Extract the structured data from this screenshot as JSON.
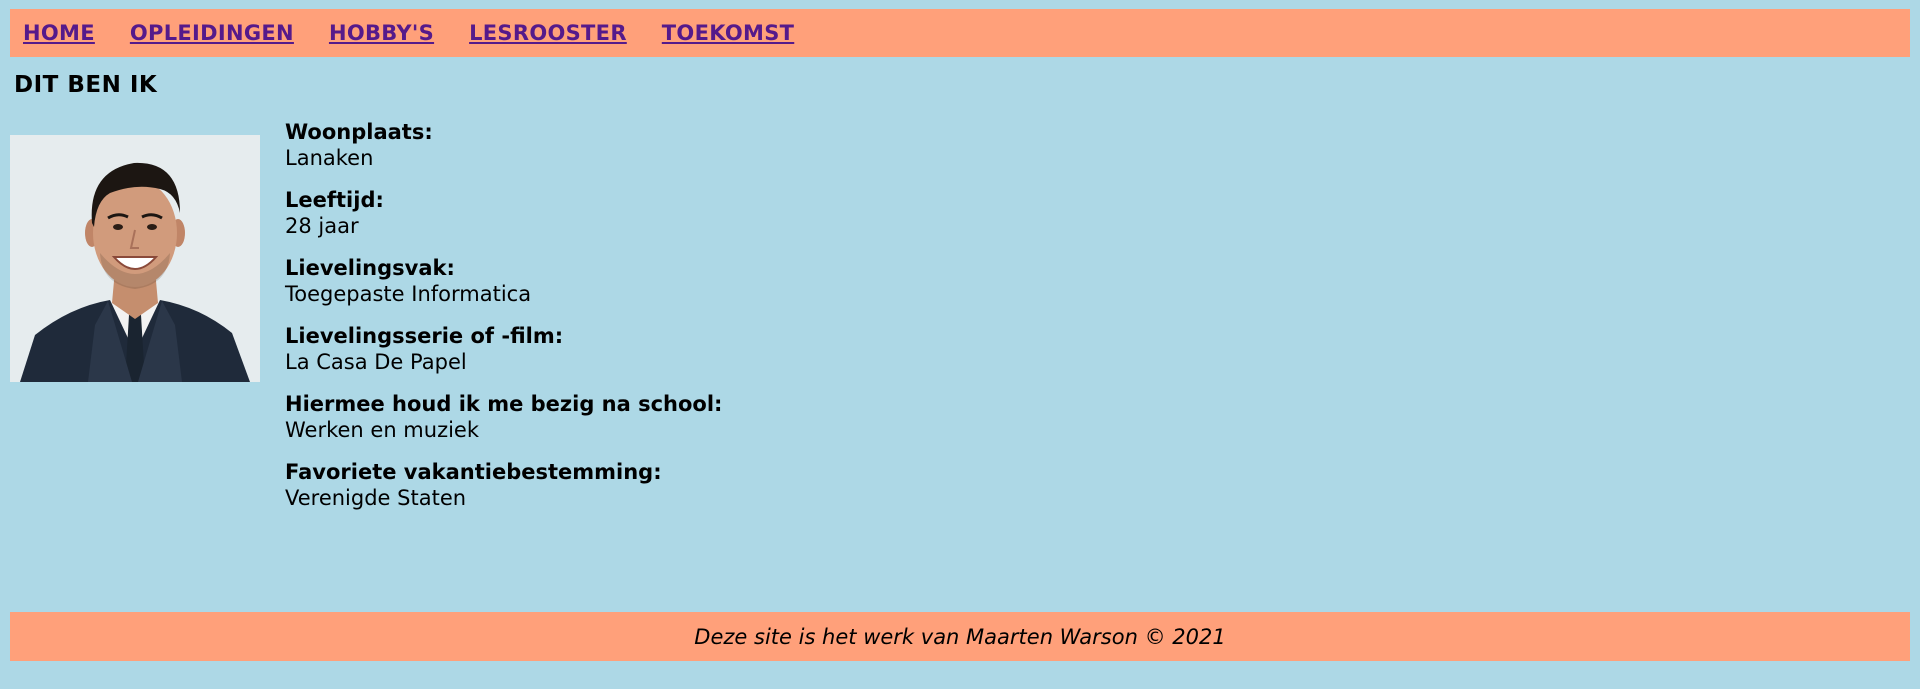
{
  "nav": {
    "items": [
      {
        "label": "HOME"
      },
      {
        "label": "OPLEIDINGEN"
      },
      {
        "label": "HOBBY'S"
      },
      {
        "label": "LESROOSTER"
      },
      {
        "label": "TOEKOMST"
      }
    ]
  },
  "page": {
    "title": "DIT BEN IK"
  },
  "profile": {
    "items": [
      {
        "label": "Woonplaats:",
        "value": "Lanaken"
      },
      {
        "label": "Leeftijd:",
        "value": "28 jaar"
      },
      {
        "label": "Lievelingsvak:",
        "value": "Toegepaste Informatica"
      },
      {
        "label": "Lievelingsserie of -film:",
        "value": "La Casa De Papel"
      },
      {
        "label": "Hiermee houd ik me bezig na school:",
        "value": "Werken en muziek"
      },
      {
        "label": "Favoriete vakantiebestemming:",
        "value": "Verenigde Staten"
      }
    ]
  },
  "footer": {
    "text": "Deze site is het werk van Maarten Warson © 2021"
  },
  "colors": {
    "background": "#add8e6",
    "nav_bar": "#ffa07a",
    "link": "#551a8b"
  }
}
